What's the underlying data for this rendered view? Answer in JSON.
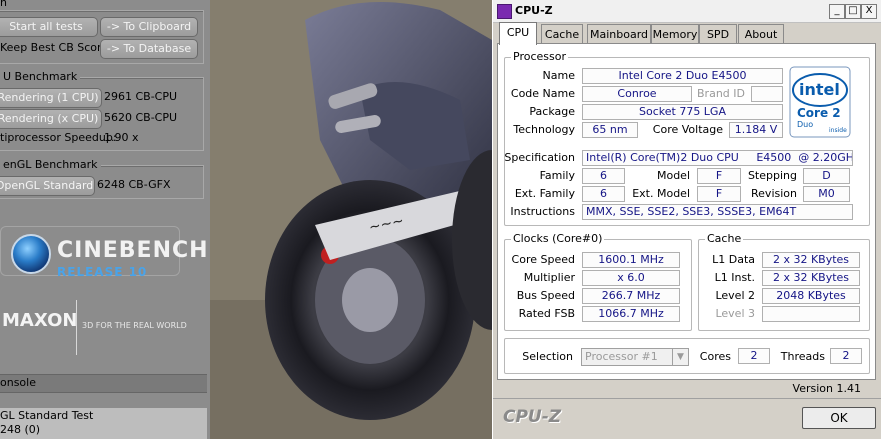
{
  "cinebench": {
    "top_cut": "n",
    "start_all_tests": "Start all tests",
    "to_clipboard": "-> To Clipboard",
    "keep_best": "Keep Best CB Score",
    "to_database": "-> To Database",
    "cpu_bench_title": "U Benchmark",
    "rendering_1cpu": "Rendering (1 CPU)",
    "rendering_1cpu_score": "2961 CB-CPU",
    "rendering_xcpu": "Rendering (x CPU)",
    "rendering_xcpu_score": "5620 CB-CPU",
    "speedup_label": "tiprocessor Speedup:",
    "speedup_value": "1.90 x",
    "opengl_title": "enGL Benchmark",
    "opengl_standard": "OpenGL Standard",
    "opengl_score": "6248 CB-GFX",
    "logo_name": "CINEBENCH",
    "logo_release": "RELEASE 10",
    "maxon": "MAXON",
    "maxon_tagline": "3D FOR THE REAL WORLD",
    "console_title": "onsole",
    "console_line1": "GL Standard Test",
    "console_line2": "248 (0)"
  },
  "cpuz": {
    "title": "CPU-Z",
    "window_buttons": [
      "_",
      "□",
      "X"
    ],
    "tabs": [
      "CPU",
      "Cache",
      "Mainboard",
      "Memory",
      "SPD",
      "About"
    ],
    "processor": {
      "group_title": "Processor",
      "name_label": "Name",
      "name": "Intel Core 2 Duo E4500",
      "codename_label": "Code Name",
      "codename": "Conroe",
      "brandid_label": "Brand ID",
      "brandid": "",
      "package_label": "Package",
      "package": "Socket 775 LGA",
      "technology_label": "Technology",
      "technology": "65 nm",
      "corevoltage_label": "Core Voltage",
      "corevoltage": "1.184 V",
      "specification_label": "Specification",
      "specification": "Intel(R) Core(TM)2 Duo CPU     E4500  @ 2.20GHz",
      "family_label": "Family",
      "family": "6",
      "model_label": "Model",
      "model": "F",
      "stepping_label": "Stepping",
      "stepping": "D",
      "extfamily_label": "Ext. Family",
      "extfamily": "6",
      "extmodel_label": "Ext. Model",
      "extmodel": "F",
      "revision_label": "Revision",
      "revision": "M0",
      "instructions_label": "Instructions",
      "instructions": "MMX, SSE, SSE2, SSE3, SSSE3, EM64T"
    },
    "intel_logo": {
      "brand": "intel",
      "line1": "Core 2",
      "line2": "Duo",
      "line3": "inside"
    },
    "clocks": {
      "group_title": "Clocks (Core#0)",
      "corespeed_label": "Core Speed",
      "corespeed": "1600.1 MHz",
      "multiplier_label": "Multiplier",
      "multiplier": "x 6.0",
      "busspeed_label": "Bus Speed",
      "busspeed": "266.7 MHz",
      "ratedfsb_label": "Rated FSB",
      "ratedfsb": "1066.7 MHz"
    },
    "cache": {
      "group_title": "Cache",
      "l1data_label": "L1 Data",
      "l1data": "2 x 32 KBytes",
      "l1inst_label": "L1 Inst.",
      "l1inst": "2 x 32 KBytes",
      "level2_label": "Level 2",
      "level2": "2048 KBytes",
      "level3_label": "Level 3",
      "level3": ""
    },
    "selection_label": "Selection",
    "selection_value": "Processor #1",
    "cores_label": "Cores",
    "cores": "2",
    "threads_label": "Threads",
    "threads": "2",
    "version": "Version 1.41",
    "footer_logo": "CPU-Z",
    "ok": "OK"
  }
}
